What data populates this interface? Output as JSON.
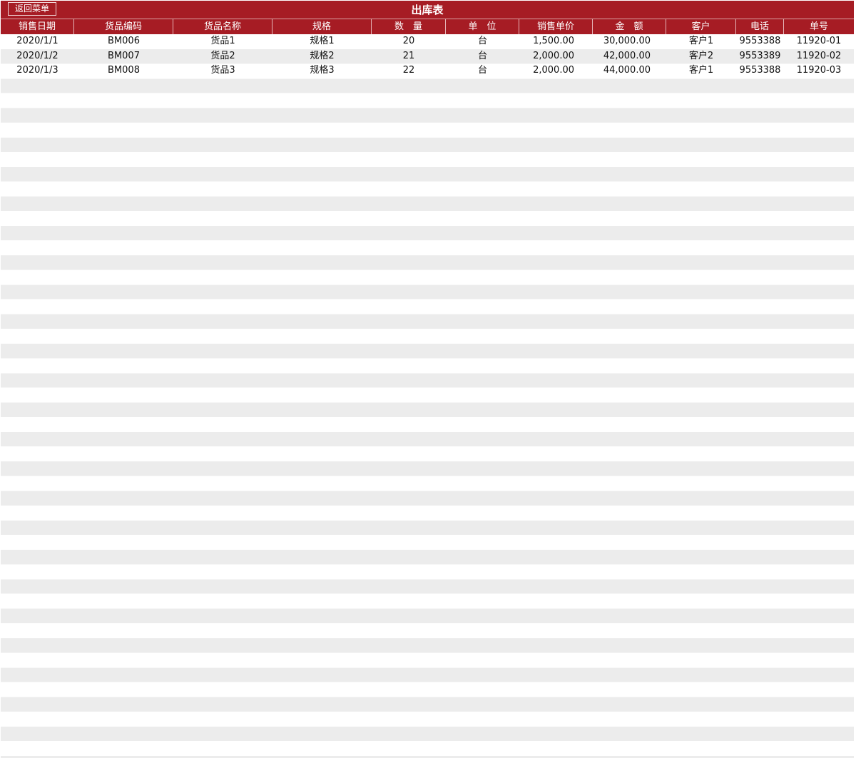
{
  "toolbar": {
    "back_label": "返回菜单",
    "title": "出库表"
  },
  "columns": [
    "销售日期",
    "货品编码",
    "货品名称",
    "规格",
    "数　量",
    "单　位",
    "销售单价",
    "金　额",
    "客户",
    "电话",
    "单号"
  ],
  "rows": [
    [
      "2020/1/1",
      "BM006",
      "货品1",
      "规格1",
      "20",
      "台",
      "1,500.00",
      "30,000.00",
      "客户1",
      "9553388",
      "11920-01"
    ],
    [
      "2020/1/2",
      "BM007",
      "货品2",
      "规格2",
      "21",
      "台",
      "2,000.00",
      "42,000.00",
      "客户2",
      "9553389",
      "11920-02"
    ],
    [
      "2020/1/3",
      "BM008",
      "货品3",
      "规格3",
      "22",
      "台",
      "2,000.00",
      "44,000.00",
      "客户1",
      "9553388",
      "11920-03"
    ]
  ],
  "colors": {
    "header_bg": "#a61c24",
    "header_text": "#ffffff",
    "stripe": "#ececec"
  }
}
